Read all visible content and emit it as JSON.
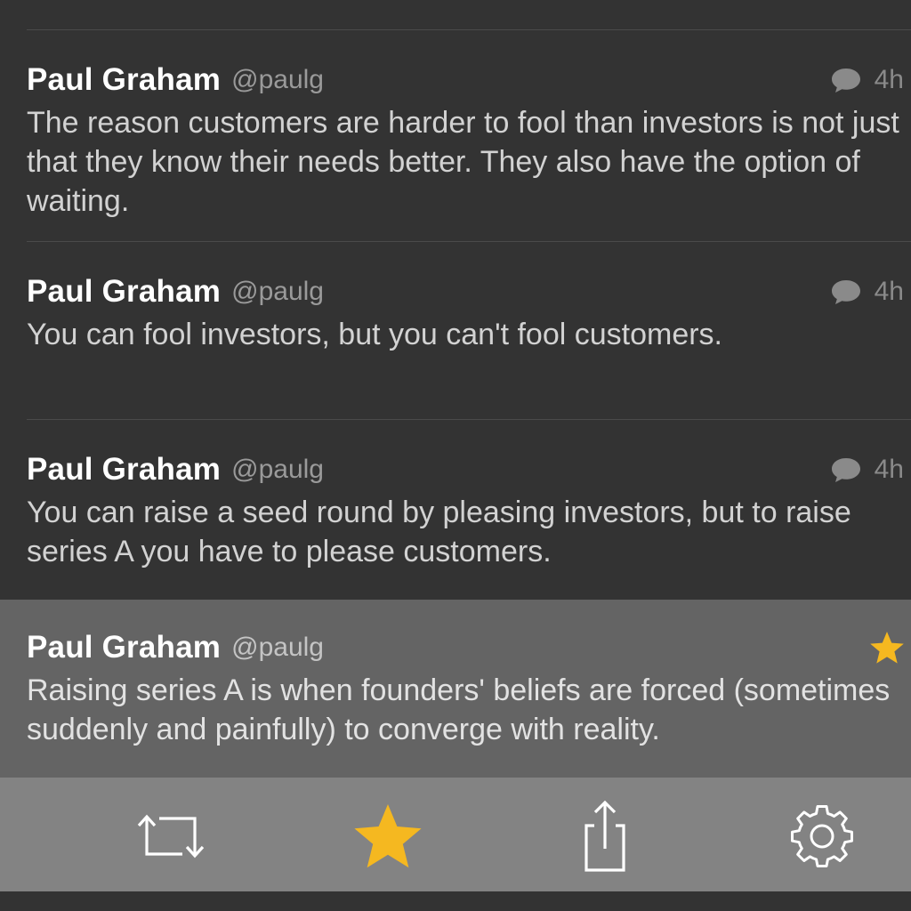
{
  "tweets": [
    {
      "name": "Paul Graham",
      "handle": "@paulg",
      "time": "4h",
      "icon": "reply-bubble-icon",
      "text": "The reason customers are harder to fool than investors is not just that they know their needs better. They also have the option of waiting."
    },
    {
      "name": "Paul Graham",
      "handle": "@paulg",
      "time": "4h",
      "icon": "reply-bubble-icon",
      "text": "You can fool investors, but you can't fool customers."
    },
    {
      "name": "Paul Graham",
      "handle": "@paulg",
      "time": "4h",
      "icon": "reply-bubble-icon",
      "text": "You can raise a seed round by pleasing investors, but to raise series A you have to please customers."
    },
    {
      "name": "Paul Graham",
      "handle": "@paulg",
      "favorited": true,
      "icon": "star-icon",
      "text": "Raising series A is when founders' beliefs are forced (sometimes suddenly and painfully) to converge with reality."
    }
  ],
  "toolbar": {
    "actions": [
      {
        "icon": "retweet-icon"
      },
      {
        "icon": "star-icon",
        "active": true
      },
      {
        "icon": "share-icon"
      },
      {
        "icon": "gear-icon"
      }
    ]
  },
  "colors": {
    "background": "#333333",
    "selected_row": "#646464",
    "toolbar": "#838383",
    "accent_star": "#f5b820"
  }
}
